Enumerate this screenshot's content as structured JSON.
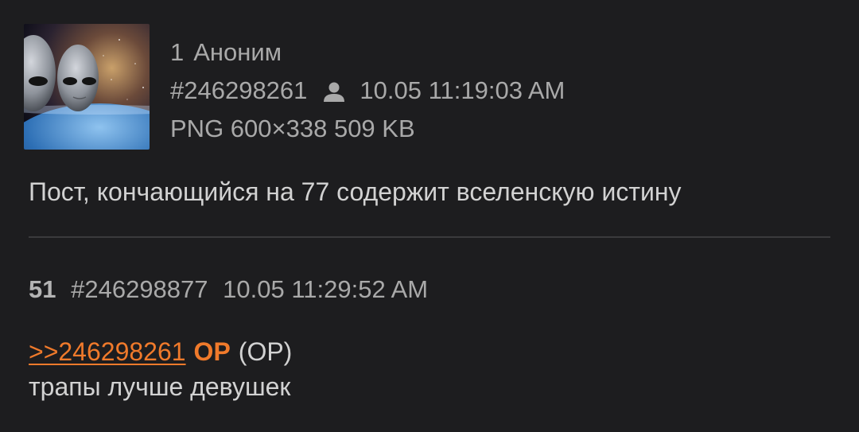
{
  "op_post": {
    "number": "1",
    "author": "Аноним",
    "post_id": "#246298261",
    "datetime": "10.05 11:19:03 AM",
    "file_info": "PNG 600×338 509 KB",
    "body": "Пост, кончающийся на 77 содержит вселенскую истину",
    "thumbnail_icon": "alien-space-thumbnail"
  },
  "reply_post": {
    "number": "51",
    "post_id": "#246298877",
    "datetime": "10.05 11:29:52 AM",
    "quote_link": ">>246298261",
    "op_badge": "OP",
    "op_paren": "(OP)",
    "body": "трапы лучше девушек"
  },
  "colors": {
    "background": "#1d1d1f",
    "meta_text": "#a9a9a9",
    "body_text": "#d2d2d2",
    "accent": "#f07a2b",
    "divider": "#3a3a3c"
  }
}
